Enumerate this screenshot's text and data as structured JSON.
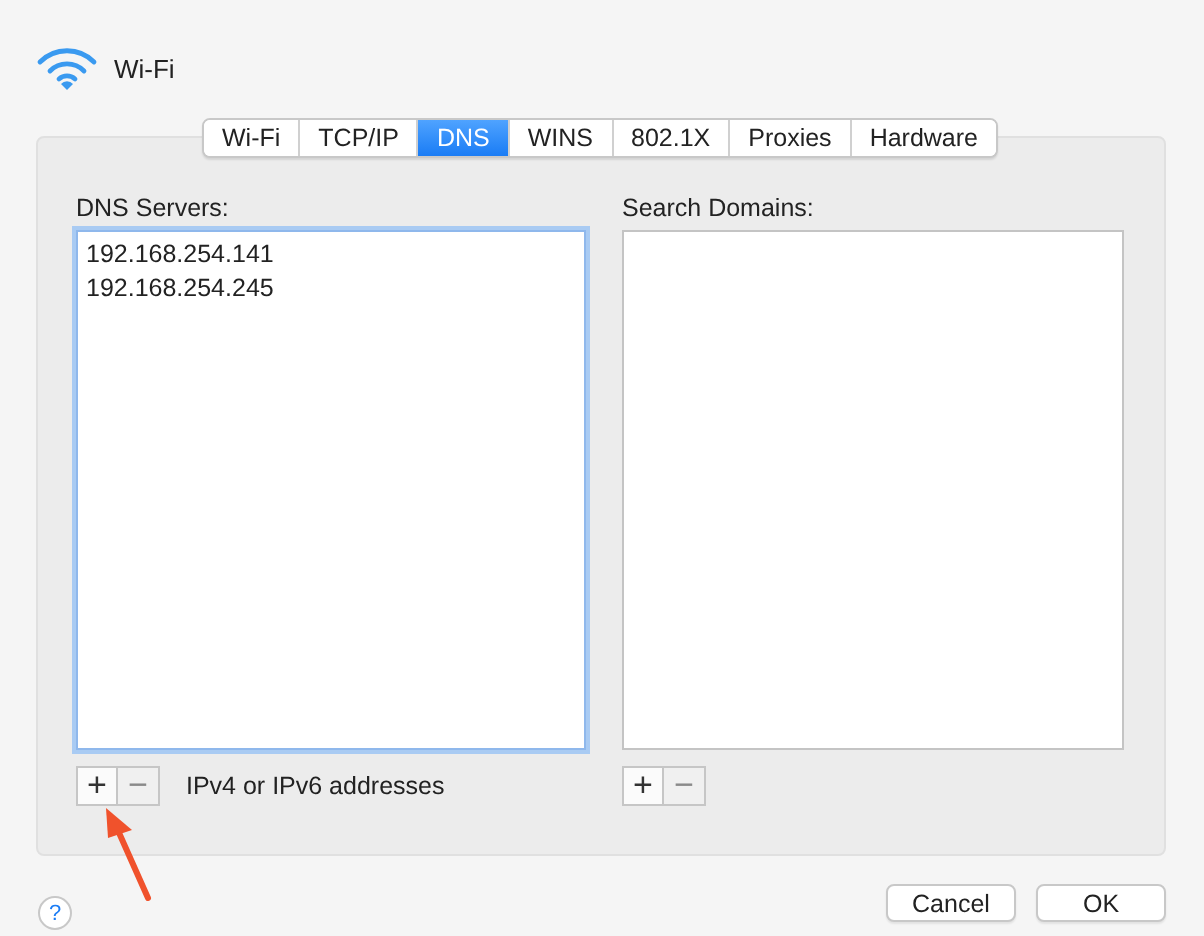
{
  "window": {
    "title": "Wi-Fi"
  },
  "tabs": [
    {
      "label": "Wi-Fi",
      "selected": false
    },
    {
      "label": "TCP/IP",
      "selected": false
    },
    {
      "label": "DNS",
      "selected": true
    },
    {
      "label": "WINS",
      "selected": false
    },
    {
      "label": "802.1X",
      "selected": false
    },
    {
      "label": "Proxies",
      "selected": false
    },
    {
      "label": "Hardware",
      "selected": false
    }
  ],
  "dns_servers": {
    "label": "DNS Servers:",
    "focused": true,
    "entries": [
      "192.168.254.141",
      "192.168.254.245"
    ],
    "add_button": {
      "label": "+",
      "disabled": false
    },
    "remove_button": {
      "label": "−",
      "disabled": true
    },
    "hint": "IPv4 or IPv6 addresses"
  },
  "search_domains": {
    "label": "Search Domains:",
    "focused": false,
    "add_button": {
      "label": "+",
      "disabled": false
    },
    "remove_button": {
      "label": "−",
      "disabled": true
    }
  },
  "help_button": "?",
  "buttons": [
    "Cancel",
    "OK"
  ]
}
